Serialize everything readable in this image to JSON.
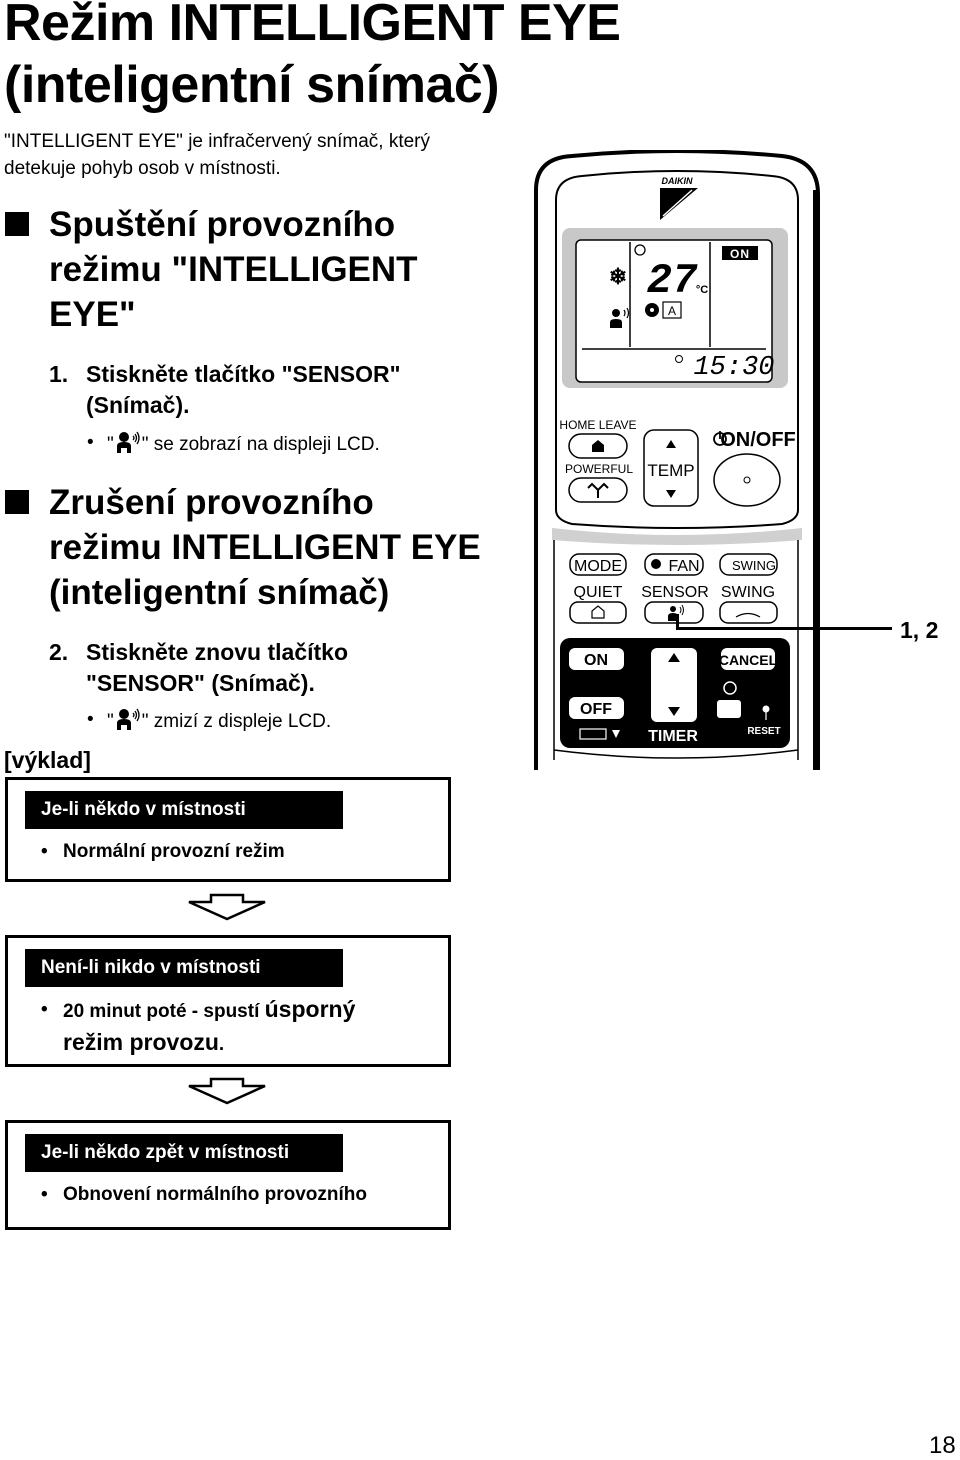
{
  "page": {
    "title_line1": "Režim INTELLIGENT EYE",
    "title_line2": "(inteligentní snímač)",
    "intro_line1": "\"INTELLIGENT EYE\" je infračervený snímač, který",
    "intro_line2": "detekuje pohyb osob v místnosti.",
    "page_number": "18"
  },
  "sections": [
    {
      "heading_lines": [
        "Spuštění provozního",
        "režimu \"INTELLIGENT",
        "EYE\""
      ],
      "step_number": "1.",
      "step_lines": [
        "Stiskněte tlačítko \"SENSOR\"",
        "(Snímač)."
      ],
      "bullet_prefix": "\"",
      "bullet_icon": "intelligent-eye-person-icon",
      "bullet_suffix": "\" se zobrazí na displeji LCD."
    },
    {
      "heading_lines": [
        "Zrušení provozního",
        "režimu INTELLIGENT EYE",
        "(inteligentní snímač)"
      ],
      "step_number": "2.",
      "step_lines": [
        "Stiskněte znovu tlačítko",
        "\"SENSOR\" (Snímač)."
      ],
      "bullet_prefix": "\"",
      "bullet_icon": "intelligent-eye-person-icon",
      "bullet_suffix": "\" zmizí z displeje LCD."
    }
  ],
  "explanation": {
    "label": "[výklad]",
    "boxes": [
      {
        "heading": "Je-li někdo v místnosti",
        "item_parts": [
          "Normální provozní režim"
        ]
      },
      {
        "heading": "Není-li nikdo v místnosti",
        "item_small": "20 minut poté - spustí ",
        "item_big1": "úsporný",
        "item_big2": "režim provozu",
        "item_end": "."
      },
      {
        "heading": "Je-li někdo zpět v místnosti",
        "item_parts": [
          "Obnovení normálního provozního"
        ]
      }
    ],
    "bullet_char": "•"
  },
  "callout": {
    "label": "1, 2"
  },
  "remote": {
    "brand": "DAIKIN",
    "lcd": {
      "temperature": "27",
      "unit": "°C",
      "status": "ON",
      "clock": "15:30",
      "mode_icon": "snowflake-cool-icon",
      "fan_mode": "A"
    },
    "buttons": {
      "home_leave": "HOME LEAVE",
      "powerful": "POWERFUL",
      "temp": "TEMP",
      "on_off": "ON/OFF",
      "mode": "MODE",
      "fan": "FAN",
      "swing_top": "SWING",
      "quiet": "QUIET",
      "sensor": "SENSOR",
      "swing": "SWING",
      "timer_on": "ON",
      "timer_off": "OFF",
      "timer": "TIMER",
      "cancel": "CANCEL",
      "reset": "RESET"
    }
  }
}
